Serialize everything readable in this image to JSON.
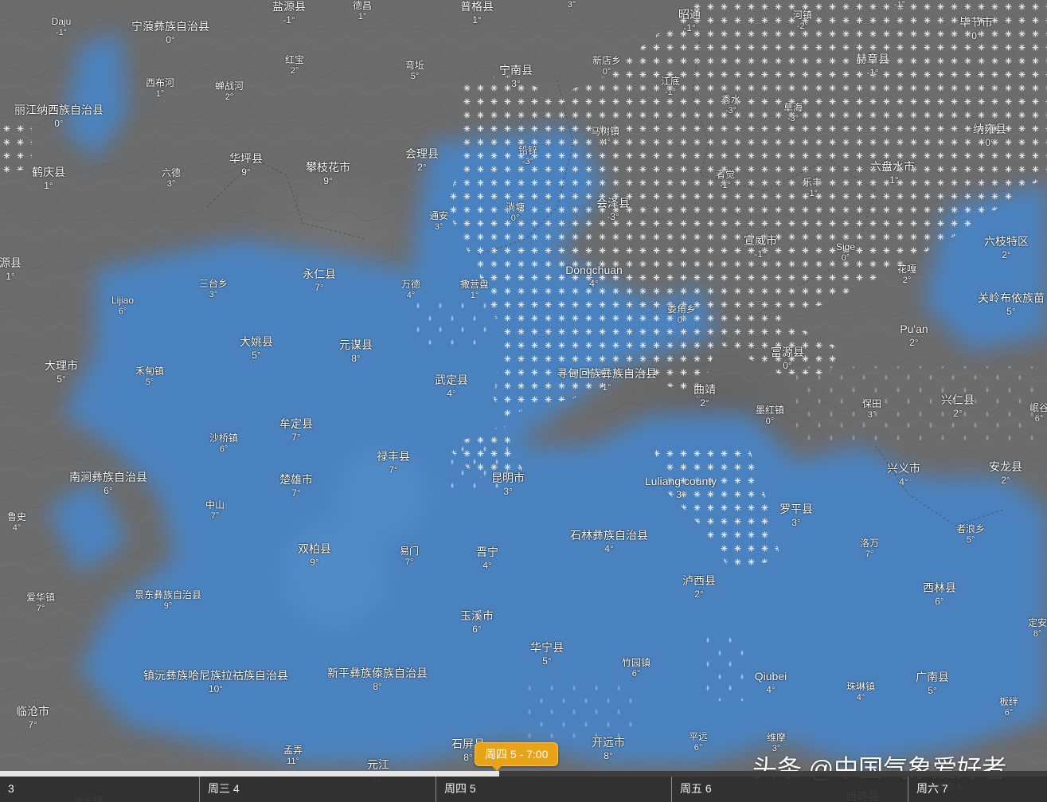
{
  "colors": {
    "terrain": "#6c6c6c",
    "precip_rain": "#4a84c4",
    "precip_snow_symbol": "#ffffff",
    "timeline_accent": "#e8a318",
    "timeline_progress": "#e6e6e6"
  },
  "cities": [
    {
      "name": "Daju",
      "temp": "-1°",
      "small": true
    },
    {
      "name": "宁蒗彝族自治县",
      "temp": "0°"
    },
    {
      "name": "盐源县",
      "temp": "-1°"
    },
    {
      "name": "德昌",
      "temp": "1°",
      "small": true
    },
    {
      "name": "普格县",
      "temp": "1°"
    },
    {
      "name": "",
      "temp": "3°",
      "small": true
    },
    {
      "name": "昭通",
      "temp": "-1°"
    },
    {
      "name": "河镇",
      "temp": "-2°",
      "small": true
    },
    {
      "name": "",
      "temp": "-1°",
      "small": true
    },
    {
      "name": "毕节市",
      "temp": "0°"
    },
    {
      "name": "红宝",
      "temp": "2°",
      "small": true
    },
    {
      "name": "弯坵",
      "temp": "5°",
      "small": true
    },
    {
      "name": "宁南县",
      "temp": "3°"
    },
    {
      "name": "新店乡",
      "temp": "0°",
      "small": true
    },
    {
      "name": "江底",
      "temp": "-1°",
      "small": true
    },
    {
      "name": "赫章县",
      "temp": "-1°"
    },
    {
      "name": "西布河",
      "temp": "1°",
      "small": true
    },
    {
      "name": "蝉战河",
      "temp": "2°",
      "small": true
    },
    {
      "name": "丽江纳西族自治县",
      "temp": "0°"
    },
    {
      "name": "秀水",
      "temp": "-3°",
      "small": true
    },
    {
      "name": "草海",
      "temp": "-3°",
      "small": true
    },
    {
      "name": "马树镇",
      "temp": "-4°",
      "small": true
    },
    {
      "name": "纳雍县",
      "temp": "0°"
    },
    {
      "name": "华坪县",
      "temp": "9°"
    },
    {
      "name": "会理县",
      "temp": "2°"
    },
    {
      "name": "铅锌",
      "temp": "-3°",
      "small": true
    },
    {
      "name": "鹤庆县",
      "temp": "1°"
    },
    {
      "name": "六德",
      "temp": "3°",
      "small": true
    },
    {
      "name": "攀枝花市",
      "temp": "9°"
    },
    {
      "name": "六盘水市",
      "temp": "-1°"
    },
    {
      "name": "者觉",
      "temp": "-1°",
      "small": true
    },
    {
      "name": "乐丰",
      "temp": "-1°",
      "small": true
    },
    {
      "name": "会泽县",
      "temp": "-3°"
    },
    {
      "name": "通安",
      "temp": "3°",
      "small": true
    },
    {
      "name": "淌塘",
      "temp": "0°",
      "small": true
    },
    {
      "name": "宣威市",
      "temp": "-1°"
    },
    {
      "name": "Sige",
      "temp": "0°",
      "small": true
    },
    {
      "name": "六枝特区",
      "temp": "2°"
    },
    {
      "name": "源县",
      "temp": "1°"
    },
    {
      "name": "花嘎",
      "temp": "2°",
      "small": true
    },
    {
      "name": "Dongchuan",
      "temp": "4°"
    },
    {
      "name": "三台乡",
      "temp": "3°",
      "small": true
    },
    {
      "name": "永仁县",
      "temp": "7°"
    },
    {
      "name": "万德",
      "temp": "4°",
      "small": true
    },
    {
      "name": "撒营盘",
      "temp": "1°",
      "small": true
    },
    {
      "name": "关岭布依族苗",
      "temp": "5°"
    },
    {
      "name": "Lijiao",
      "temp": "6°",
      "small": true
    },
    {
      "name": "娄角乡",
      "temp": "0°",
      "small": true
    },
    {
      "name": "Pu'an",
      "temp": "2°"
    },
    {
      "name": "大姚县",
      "temp": "5°"
    },
    {
      "name": "元谋县",
      "temp": "8°"
    },
    {
      "name": "富源县",
      "temp": "0°"
    },
    {
      "name": "大理市",
      "temp": "5°"
    },
    {
      "name": "禾甸镇",
      "temp": "5°",
      "small": true
    },
    {
      "name": "寻甸回族彝族自治县",
      "temp": "1°"
    },
    {
      "name": "武定县",
      "temp": "4°"
    },
    {
      "name": "曲靖",
      "temp": "2°"
    },
    {
      "name": "墨红镇",
      "temp": "0°",
      "small": true
    },
    {
      "name": "保田",
      "temp": "3°",
      "small": true
    },
    {
      "name": "兴仁县",
      "temp": "2°"
    },
    {
      "name": "岷谷",
      "temp": "6°",
      "small": true
    },
    {
      "name": "牟定县",
      "temp": "7°"
    },
    {
      "name": "沙桥镇",
      "temp": "6°",
      "small": true
    },
    {
      "name": "禄丰县",
      "temp": "7°"
    },
    {
      "name": "南涧彝族自治县",
      "temp": "6°"
    },
    {
      "name": "楚雄市",
      "temp": "7°"
    },
    {
      "name": "昆明市",
      "temp": "3°"
    },
    {
      "name": "Luliang county",
      "temp": "3°"
    },
    {
      "name": "兴义市",
      "temp": "4°"
    },
    {
      "name": "安龙县",
      "temp": "2°"
    },
    {
      "name": "中山",
      "temp": "7°",
      "small": true
    },
    {
      "name": "罗平县",
      "temp": "3°"
    },
    {
      "name": "鲁史",
      "temp": "4°",
      "small": true
    },
    {
      "name": "者浪乡",
      "temp": "5°",
      "small": true
    },
    {
      "name": "石林彝族自治县",
      "temp": "4°"
    },
    {
      "name": "洛万",
      "temp": "7°",
      "small": true
    },
    {
      "name": "双柏县",
      "temp": "9°"
    },
    {
      "name": "易门",
      "temp": "7°",
      "small": true
    },
    {
      "name": "晋宁",
      "temp": "4°"
    },
    {
      "name": "泸西县",
      "temp": "2°"
    },
    {
      "name": "西林县",
      "temp": "6°"
    },
    {
      "name": "爱华镇",
      "temp": "7°",
      "small": true
    },
    {
      "name": "景东彝族自治县",
      "temp": "9°",
      "small": true
    },
    {
      "name": "玉溪市",
      "temp": "6°"
    },
    {
      "name": "定安",
      "temp": "8°",
      "small": true
    },
    {
      "name": "华宁县",
      "temp": "5°"
    },
    {
      "name": "竹园镇",
      "temp": "6°",
      "small": true
    },
    {
      "name": "新平彝族傣族自治县",
      "temp": "8°"
    },
    {
      "name": "镇沅彝族哈尼族拉祜族自治县",
      "temp": "10°"
    },
    {
      "name": "Qiubei",
      "temp": "4°"
    },
    {
      "name": "珠琳镇",
      "temp": "4°",
      "small": true
    },
    {
      "name": "广南县",
      "temp": "5°"
    },
    {
      "name": "临沧市",
      "temp": "7°"
    },
    {
      "name": "板绊",
      "temp": "6°",
      "small": true
    },
    {
      "name": "孟弄",
      "temp": "11°",
      "small": true
    },
    {
      "name": "石屏县",
      "temp": "8°"
    },
    {
      "name": "开远市",
      "temp": "8°"
    },
    {
      "name": "平远",
      "temp": "6°",
      "small": true
    },
    {
      "name": "维摩",
      "temp": "3°",
      "small": true
    },
    {
      "name": "元江",
      "temp": "11°"
    },
    {
      "name": "永平镇",
      "temp": "",
      "small": true
    },
    {
      "name": "西畴县",
      "temp": ""
    },
    {
      "name": "新寨乡",
      "temp": "5°",
      "small": true
    }
  ],
  "timeline": {
    "progress_percent": 47.7,
    "current_label": "周四 5 - 7:00",
    "days": [
      {
        "label": "3"
      },
      {
        "label": "周三 4"
      },
      {
        "label": "周四 5"
      },
      {
        "label": "周五 6"
      },
      {
        "label": "周六 7"
      }
    ]
  },
  "watermark": "头条 @中国气象爱好者"
}
